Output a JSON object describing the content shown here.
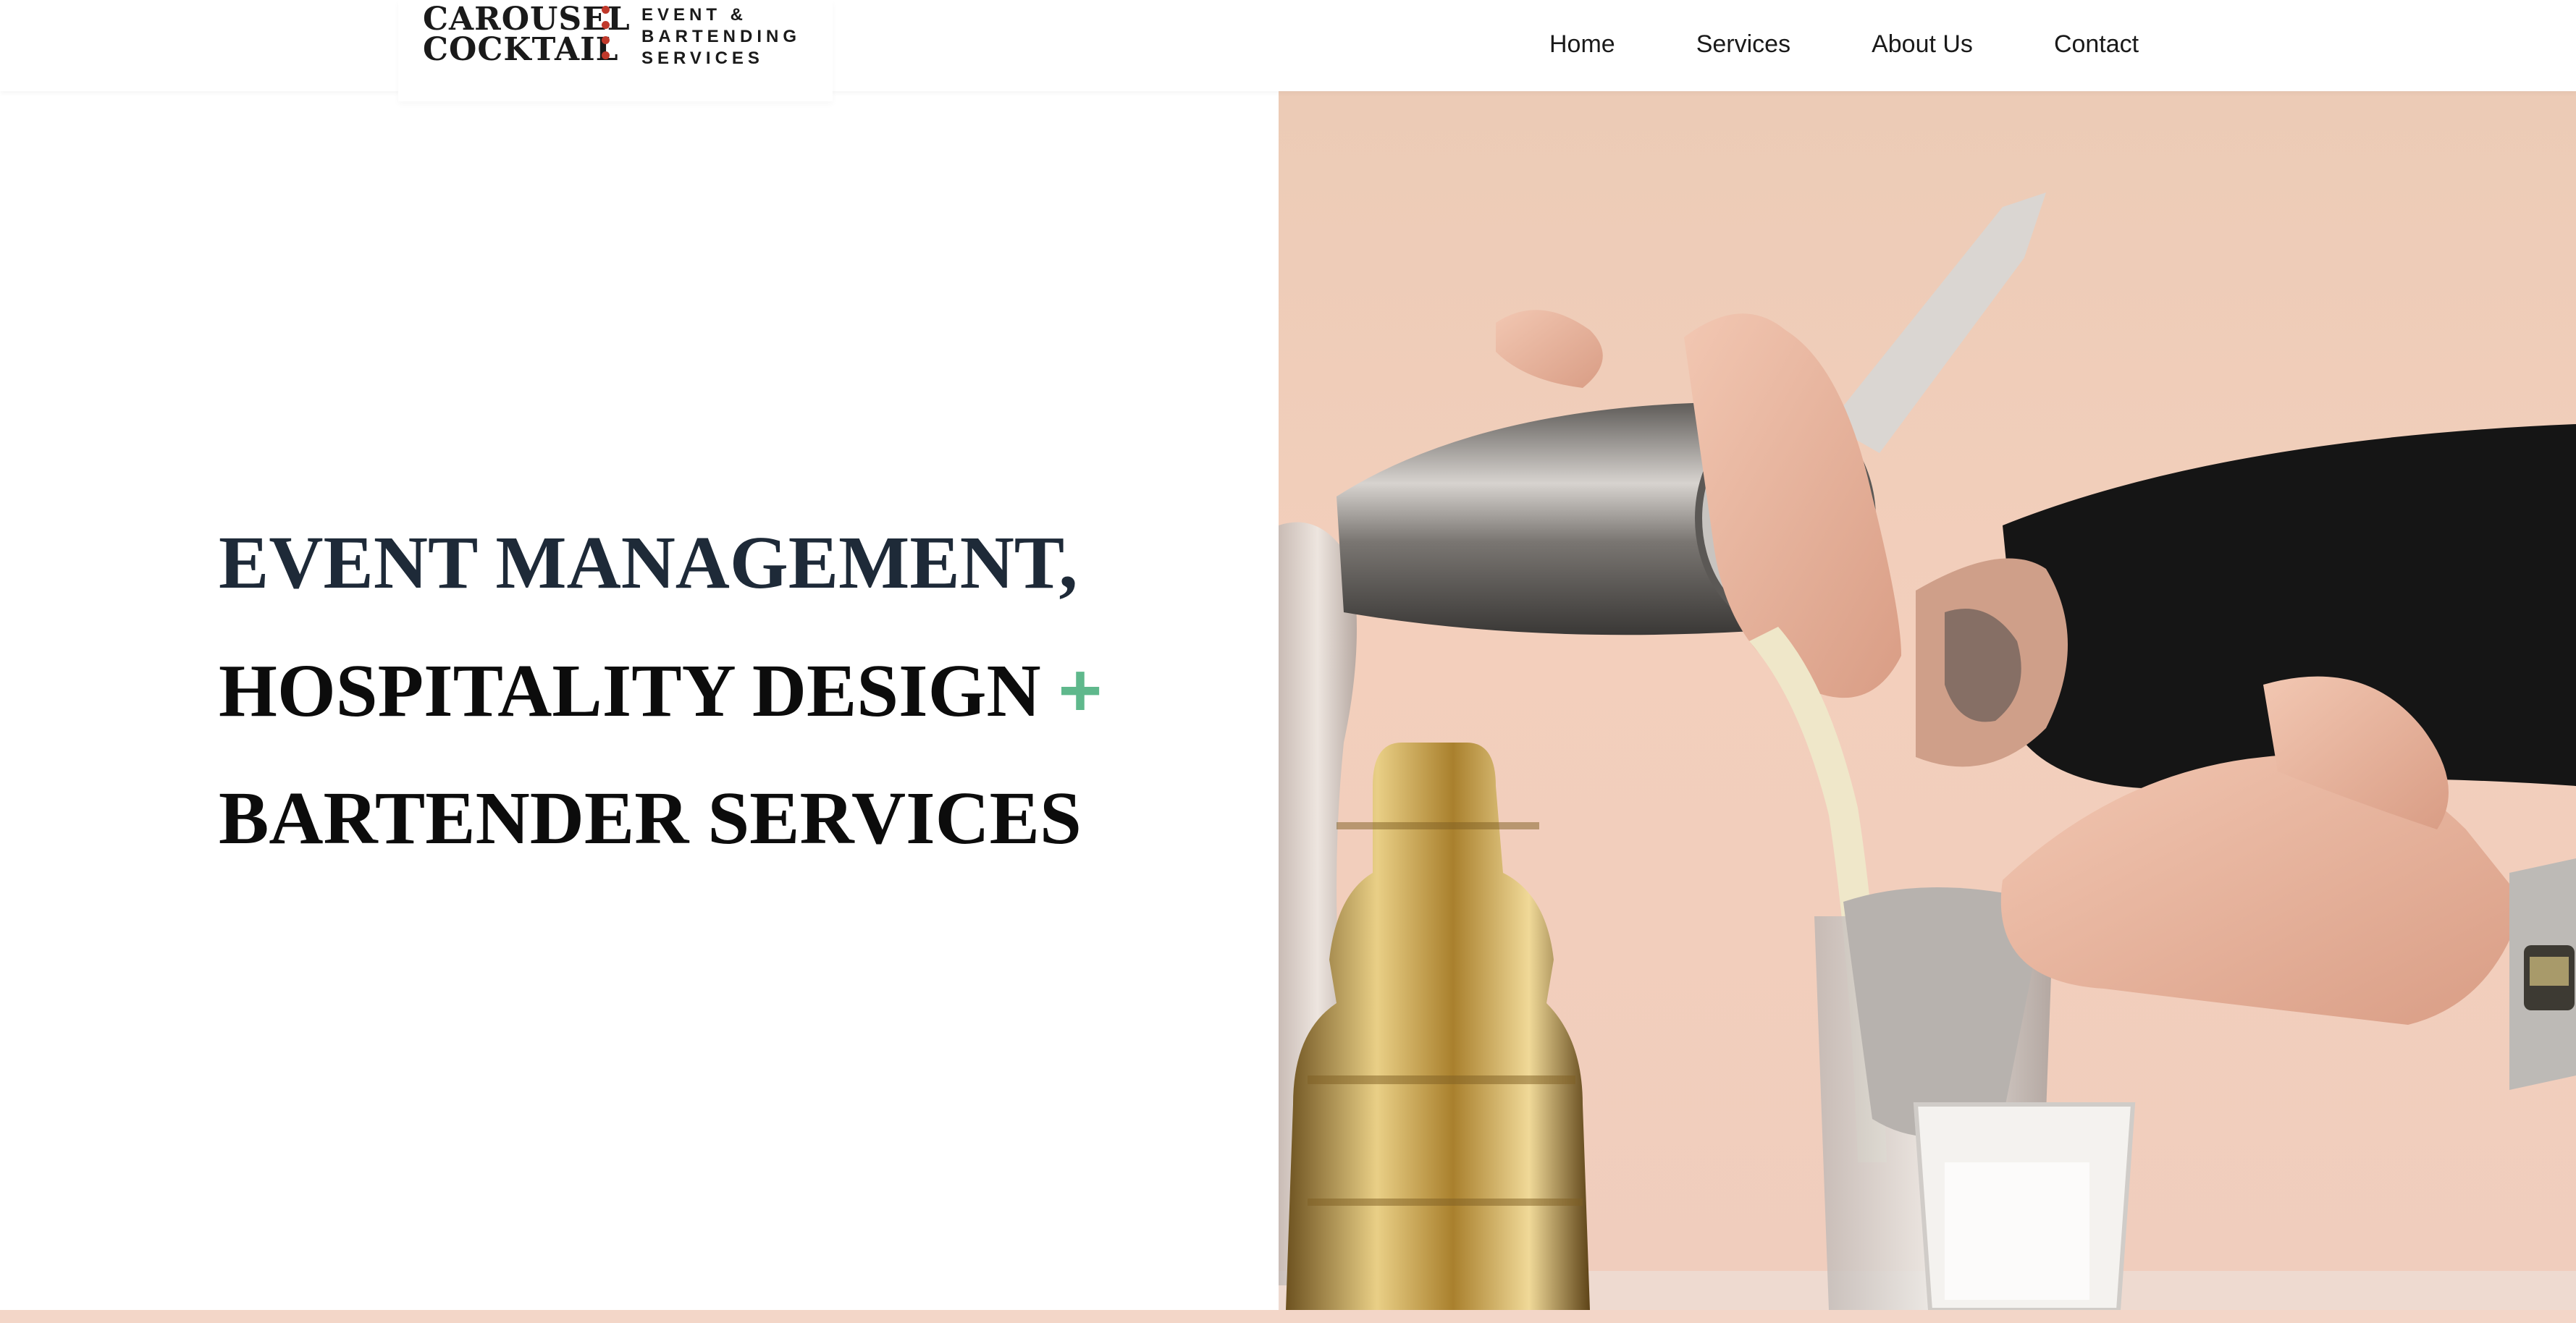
{
  "header": {
    "logo": {
      "name_lines": [
        "Carousel",
        "Cocktail"
      ],
      "tagline_lines": [
        "Event &",
        "Bartending",
        "Services"
      ],
      "dot_color": "#c0392b"
    },
    "nav": [
      {
        "label": "Home"
      },
      {
        "label": "Services"
      },
      {
        "label": "About Us"
      },
      {
        "label": "Contact"
      }
    ]
  },
  "hero": {
    "line1": "EVENT MANAGEMENT,",
    "line2": "HOSPITALITY DESIGN",
    "plus": "+",
    "line3": "BARTENDER SERVICES",
    "accent_color": "#5fb88c",
    "image": "bartender pouring cocktail from shaker through strainer into glass"
  },
  "colors": {
    "heading_dark": "#1e2a38",
    "background": "#ffffff",
    "image_background": "#eccbb6",
    "bottom_strip": "#f3d6c8"
  }
}
